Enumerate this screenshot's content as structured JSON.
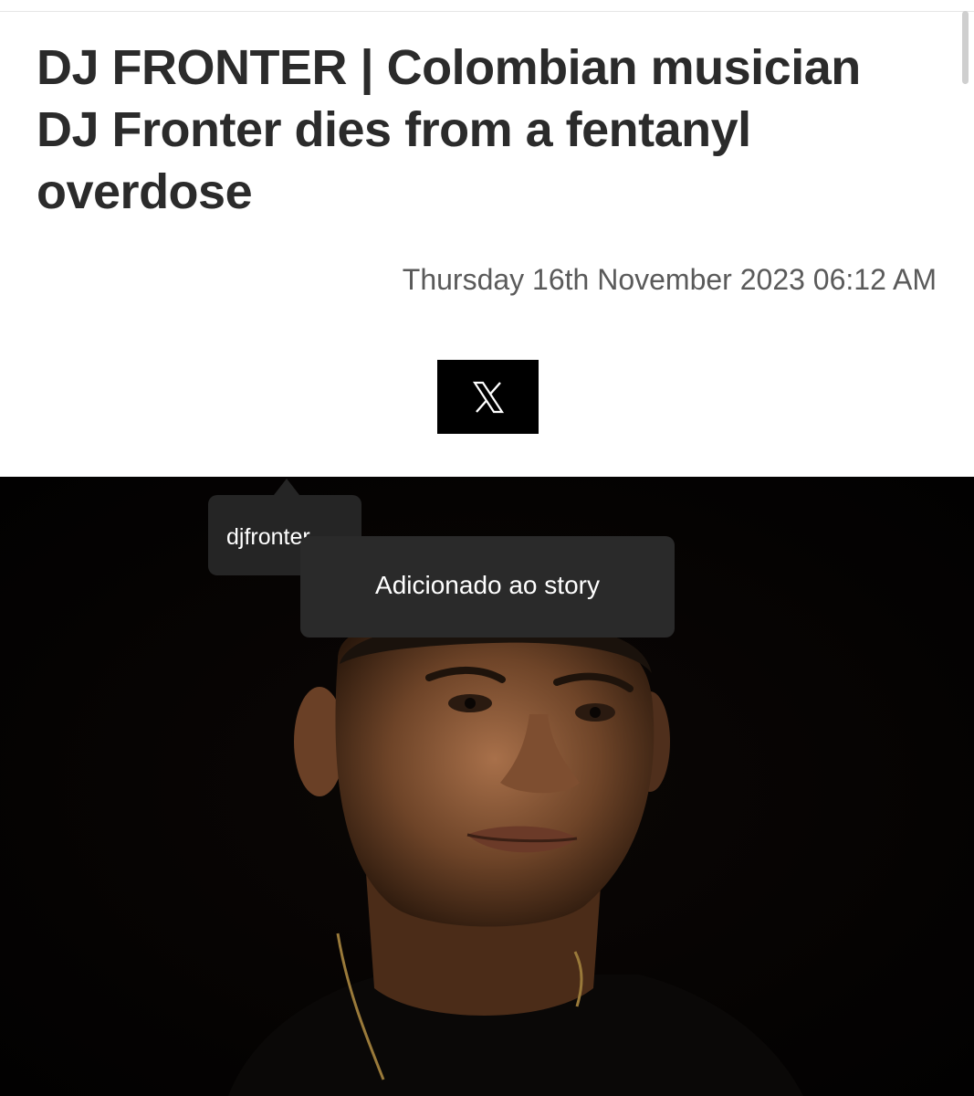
{
  "article": {
    "headline": "DJ FRONTER | Colombian musician DJ Fronter dies from a fentanyl overdose",
    "date": "Thursday 16th November 2023 06:12 AM"
  },
  "share": {
    "icon": "x-logo-icon"
  },
  "overlay": {
    "username_tag": "djfronter",
    "toast": "Adicionado ao story"
  },
  "colors": {
    "headline": "#2b2b2b",
    "date": "#5a5a5a",
    "share_button_bg": "#000000",
    "photo_bg": "#050302",
    "overlay_bg": "#2a2a2a"
  }
}
